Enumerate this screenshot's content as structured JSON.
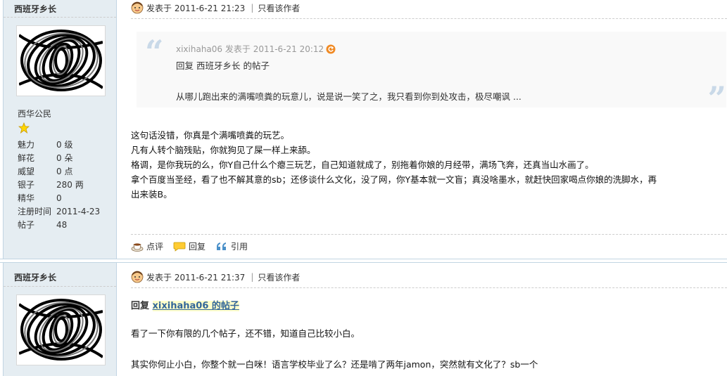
{
  "posts": [
    {
      "author": "西班牙乡长",
      "rank": "西华公民",
      "stats": [
        {
          "label": "魅力",
          "value": "0 级"
        },
        {
          "label": "鲜花",
          "value": "0 朵"
        },
        {
          "label": "威望",
          "value": "0 点"
        },
        {
          "label": "银子",
          "value": "280 两"
        },
        {
          "label": "精华",
          "value": "0"
        },
        {
          "label": "注册时间",
          "value": "2011-4-23"
        },
        {
          "label": "帖子",
          "value": "48"
        }
      ],
      "posted_label": "发表于 2011-6-21 21:23",
      "only_author": "只看该作者",
      "quote": {
        "author_line": "xixihaha06 发表于 2011-6-21 20:12",
        "reply_line": "回复 西班牙乡长 的帖子",
        "text": "从哪儿跑出来的满嘴喷粪的玩意儿，说是说一笑了之，我只看到你到处攻击，极尽嘲讽 ..."
      },
      "body": [
        "这句话没错，你真是个满嘴喷粪的玩艺。",
        "凡有人转个脑残贴，你就狗见了屎一样上来舔。",
        "格调，是你我玩的么，你Y自己什么个瘪三玩艺，自己知道就成了，别拖着你娘的月经带，满场飞奔，还真当山水画了。",
        "拿个百度当圣经，看了也不解其意的sb；还侈谈什么文化，没了网，你Y基本就一文盲；真没啥墨水，就赶快回家喝点你娘的洗脚水，再",
        "出来装B。"
      ],
      "actions": {
        "comment": "点评",
        "reply": "回复",
        "quote": "引用"
      }
    },
    {
      "author": "西班牙乡长",
      "posted_label": "发表于 2011-6-21 21:37",
      "only_author": "只看该作者",
      "reply_prefix": "回复 ",
      "reply_target": "xixihaha06 的帖子",
      "body": [
        "看了一下你有限的几个帖子，还不错，知道自己比较小白。",
        "其实你何止小白，你整个就一白咪！语言学校毕业了么？还是啃了两年jamon，突然就有文化了？sb一个"
      ]
    }
  ]
}
